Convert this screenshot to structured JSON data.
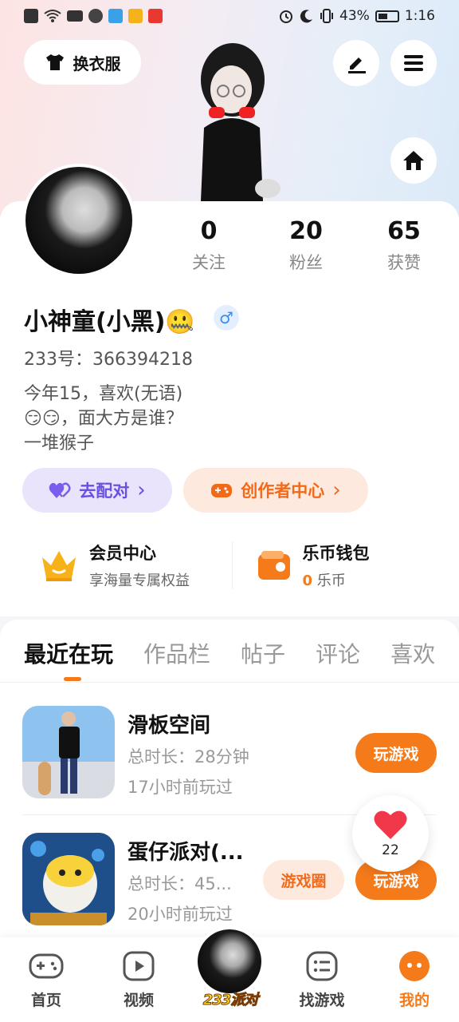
{
  "status_bar": {
    "battery": "43%",
    "time": "1:16"
  },
  "header": {
    "dress_button": "换衣服"
  },
  "stats": [
    {
      "value": "0",
      "label": "关注"
    },
    {
      "value": "20",
      "label": "粉丝"
    },
    {
      "value": "65",
      "label": "获赞"
    }
  ],
  "profile": {
    "name": "小神童(小黑)🤐",
    "gender_symbol": "♂",
    "uid": "233号：366394218",
    "bio": "今年15，喜欢(无语)\n😏😏，面大方是谁？\n一堆猴子"
  },
  "actions": {
    "pair": "去配对",
    "creator": "创作者中心",
    "chevron": "›"
  },
  "vip": {
    "title": "会员中心",
    "subtitle": "享海量专属权益",
    "wallet_title": "乐币钱包",
    "wallet_amount": "0",
    "wallet_unit": "乐币"
  },
  "tabs": [
    "最近在玩",
    "作品栏",
    "帖子",
    "评论",
    "喜欢"
  ],
  "games": [
    {
      "name": "滑板空间",
      "duration": "总时长：28分钟",
      "last_played": "17小时前玩过",
      "play_label": "玩游戏"
    },
    {
      "name": "蛋仔派对(...",
      "duration": "总时长：45...",
      "last_played": "20小时前玩过",
      "play_label": "玩游戏",
      "circle_label": "游戏圈"
    }
  ],
  "like_float": {
    "count": "22"
  },
  "bottom_nav": {
    "home": "首页",
    "video": "视频",
    "center": "233派对",
    "find_game": "找游戏",
    "mine": "我的"
  },
  "colors": {
    "accent": "#f57a1a",
    "purple": "#6a4fe0"
  }
}
